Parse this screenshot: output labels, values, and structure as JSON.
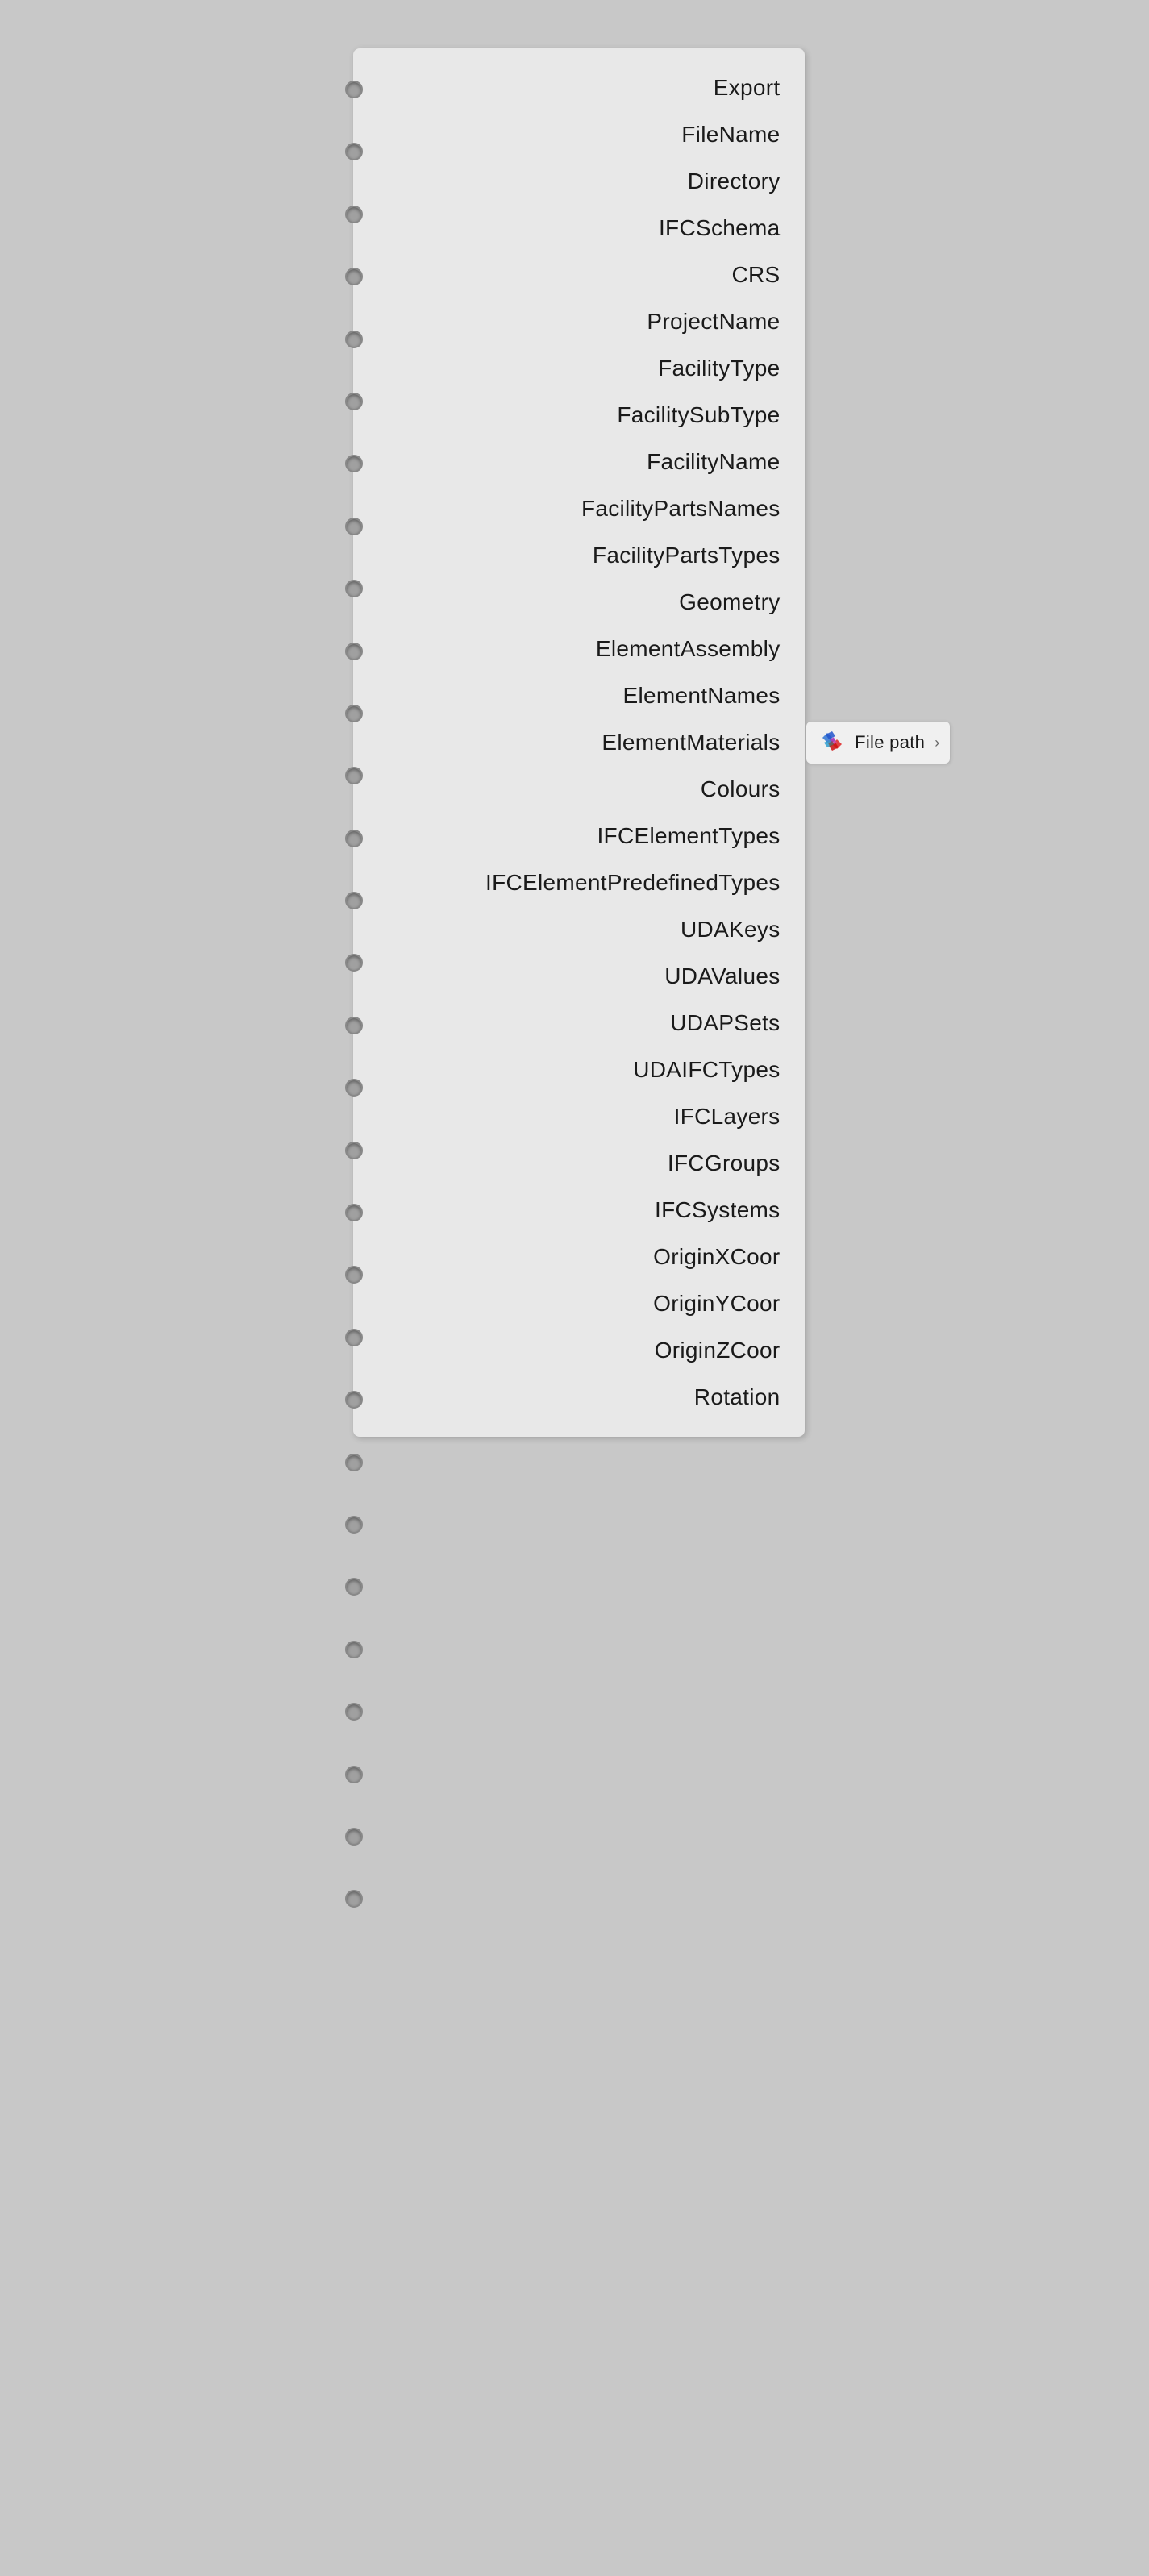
{
  "panel": {
    "items": [
      {
        "label": "Export"
      },
      {
        "label": "FileName"
      },
      {
        "label": "Directory"
      },
      {
        "label": "IFCSchema"
      },
      {
        "label": "CRS"
      },
      {
        "label": "ProjectName"
      },
      {
        "label": "FacilityType"
      },
      {
        "label": "FacilitySubType"
      },
      {
        "label": "FacilityName"
      },
      {
        "label": "FacilityPartsNames"
      },
      {
        "label": "FacilityPartsTypes"
      },
      {
        "label": "Geometry"
      },
      {
        "label": "ElementAssembly"
      },
      {
        "label": "ElementNames"
      },
      {
        "label": "ElementMaterials",
        "hasTooltip": true
      },
      {
        "label": "Colours"
      },
      {
        "label": "IFCElementTypes"
      },
      {
        "label": "IFCElementPredefinedTypes"
      },
      {
        "label": "UDAKeys"
      },
      {
        "label": "UDAValues"
      },
      {
        "label": "UDAPSets"
      },
      {
        "label": "UDAIFCTypes"
      },
      {
        "label": "IFCLayers"
      },
      {
        "label": "IFCGroups"
      },
      {
        "label": "IFCSystems"
      },
      {
        "label": "OriginXCoor"
      },
      {
        "label": "OriginYCoor"
      },
      {
        "label": "OriginZCoor"
      },
      {
        "label": "Rotation"
      }
    ],
    "tooltip": {
      "text": "File path",
      "icon_name": "app-logo-icon"
    }
  },
  "holes_count": 30
}
